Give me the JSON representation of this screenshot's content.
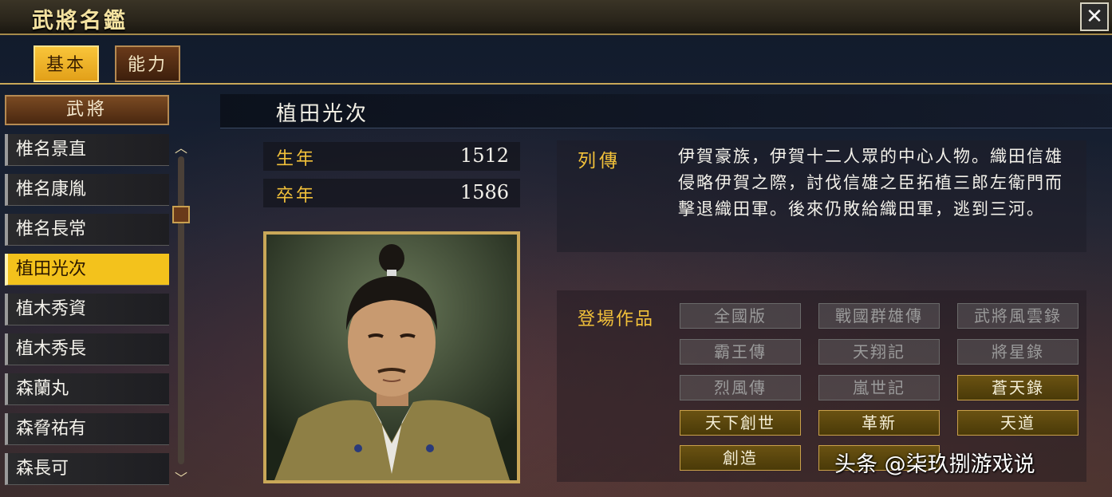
{
  "window": {
    "title": "武將名鑑",
    "close_label": "✕"
  },
  "tabs": [
    {
      "label": "基本",
      "active": true
    },
    {
      "label": "能力",
      "active": false
    }
  ],
  "list": {
    "header": "武將",
    "items": [
      {
        "label": "椎名景直"
      },
      {
        "label": "椎名康胤"
      },
      {
        "label": "椎名長常"
      },
      {
        "label": "植田光次"
      },
      {
        "label": "植木秀資"
      },
      {
        "label": "植木秀長"
      },
      {
        "label": "森蘭丸"
      },
      {
        "label": "森脅祐有"
      },
      {
        "label": "森長可"
      }
    ],
    "selected_index": 3
  },
  "general": {
    "name": "植田光次",
    "birth_label": "生年",
    "birth_year": "1512",
    "death_label": "卒年",
    "death_year": "1586"
  },
  "bio": {
    "label": "列傳",
    "text": "伊賀豪族，伊賀十二人眾的中心人物。織田信雄侵略伊賀之際，討伐信雄之臣拓植三郎左衛門而擊退織田軍。後來仍敗給織田軍，逃到三河。"
  },
  "works": {
    "label": "登場作品",
    "items": [
      {
        "label": "全國版",
        "appeared": false
      },
      {
        "label": "戰國群雄傳",
        "appeared": false
      },
      {
        "label": "武將風雲錄",
        "appeared": false
      },
      {
        "label": "霸王傳",
        "appeared": false
      },
      {
        "label": "天翔記",
        "appeared": false
      },
      {
        "label": "將星錄",
        "appeared": false
      },
      {
        "label": "烈風傳",
        "appeared": false
      },
      {
        "label": "嵐世記",
        "appeared": false
      },
      {
        "label": "蒼天錄",
        "appeared": true
      },
      {
        "label": "天下創世",
        "appeared": true
      },
      {
        "label": "革新",
        "appeared": true
      },
      {
        "label": "天道",
        "appeared": true
      },
      {
        "label": "創造",
        "appeared": true
      },
      {
        "label": "",
        "appeared": true
      }
    ]
  },
  "watermark": "头条 @柒玖捌游戏说",
  "colors": {
    "accent_gold": "#f2c13a",
    "selected_bg": "#f3c21c",
    "frame_gold": "#c9a758"
  }
}
